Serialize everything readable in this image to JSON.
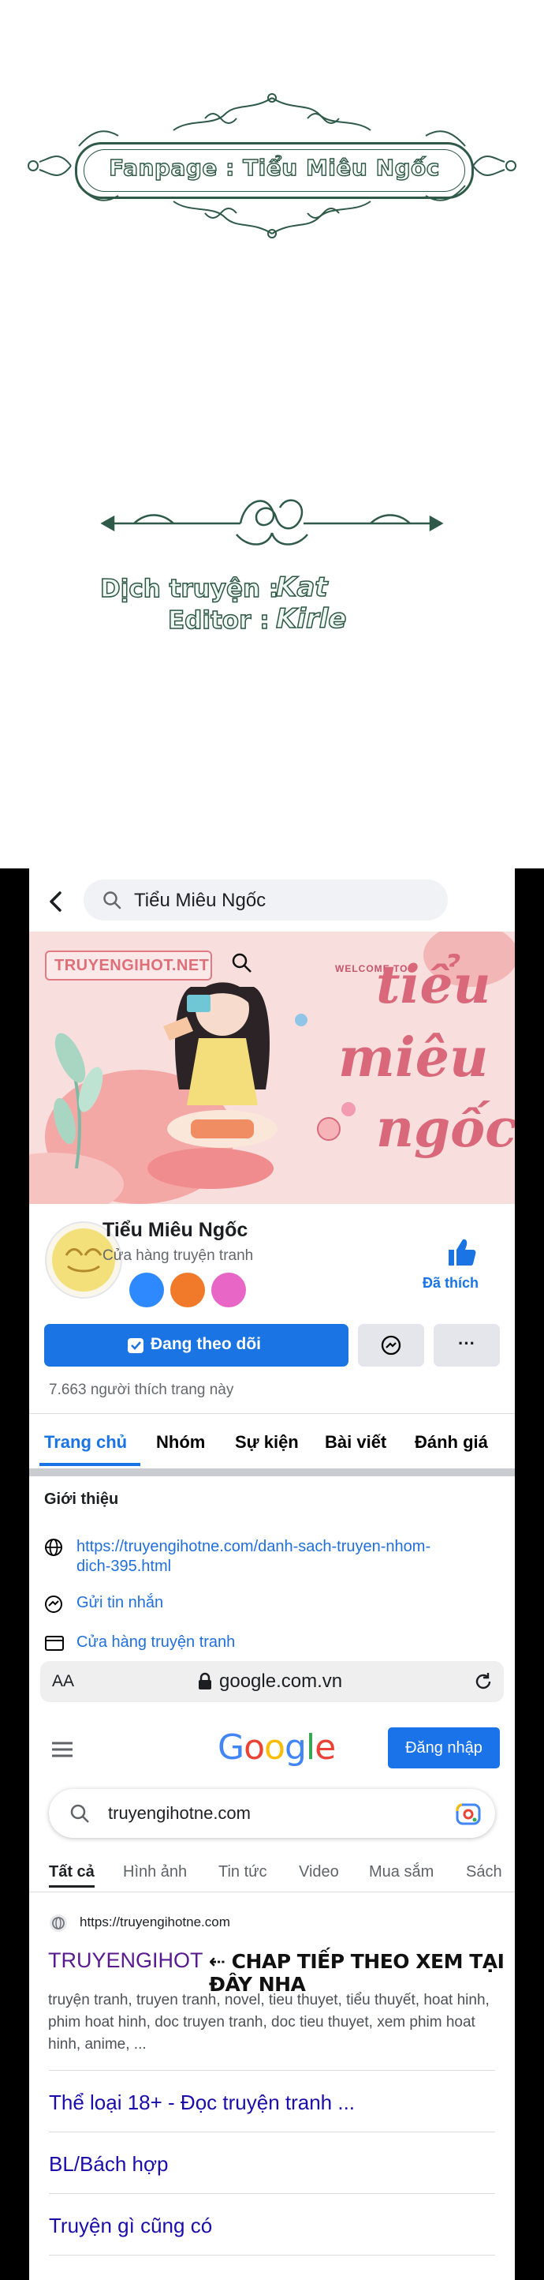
{
  "credits": {
    "fanpage": "Fanpage : Tiểu Miêu Ngốc",
    "translator_label": "Dịch truyện :",
    "translator_name": "Kat",
    "editor_label": "Editor :",
    "editor_name": "Kirle",
    "accent_color": "#2d5646"
  },
  "facebook": {
    "search_text": "Tiểu Miêu Ngốc",
    "cover": {
      "badge": "TRUYENGIHOT.NET",
      "welcome": "WELCOME TO",
      "word1": "tiểu",
      "word2": "miêu",
      "word3": "ngốc"
    },
    "page_name": "Tiểu Miêu Ngốc",
    "page_category": "Cửa hàng truyện tranh",
    "like_label": "Đã thích",
    "follow_label": "Đang theo dõi",
    "more_label": "···",
    "likes_count": "7.663 người thích trang này",
    "tabs": [
      "Trang chủ",
      "Nhóm",
      "Sự kiện",
      "Bài viết",
      "Đánh giá"
    ],
    "intro_title": "Giới thiệu",
    "website_line1": "https://truyengihotne.com/danh-sach-truyen-nhom-",
    "website_line2": "dich-395.html",
    "message_label": "Gửi tin nhắn",
    "category_label": "Cửa hàng truyện tranh",
    "brand_color": "#1b74e4"
  },
  "safari": {
    "aa": "AA",
    "domain": "google.com.vn"
  },
  "google": {
    "logo": "Google",
    "signin": "Đăng nhập",
    "query": "truyengihotne.com",
    "tabs": [
      "Tất cả",
      "Hình ảnh",
      "Tin tức",
      "Video",
      "Mua sắm",
      "Sách"
    ],
    "result": {
      "url": "https://truyengihotne.com",
      "title": "TRUYENGIHOT",
      "note": "⇠ CHAP TIẾP THEO XEM TẠI ĐÂY NHA",
      "description": "truyện tranh, truyen tranh, novel, tieu thuyet, tiểu thuyết, hoat hinh, phim hoat hinh, doc truyen tranh, doc tieu thuyet, xem phim hoat hinh, anime, ...",
      "sitelinks": [
        "Thể loại 18+ - Đọc truyện tranh ...",
        "BL/Bách hợp",
        "Truyện gì cũng có"
      ]
    }
  }
}
